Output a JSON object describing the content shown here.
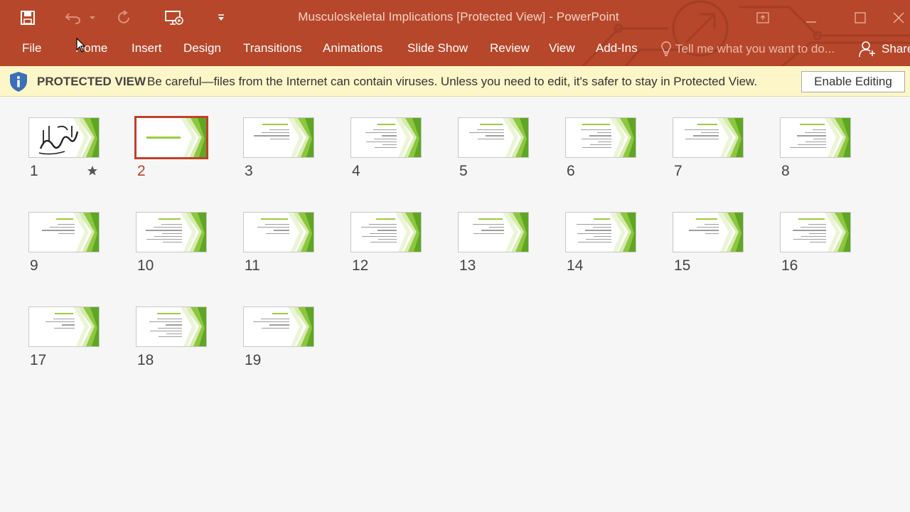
{
  "window": {
    "title": "Musculoskeletal Implications [Protected View] - PowerPoint"
  },
  "colors": {
    "accent": "#b7472a",
    "selected": "#c0412a",
    "protected_bar": "#fdf6c8",
    "thumb_green": "#8dc63f"
  },
  "quick_access": {
    "save_icon": "save-icon",
    "undo_icon": "undo-icon",
    "redo_icon": "redo-icon",
    "present_icon": "present-from-beginning-icon",
    "customize_icon": "customize-toolbar-icon"
  },
  "ribbon": {
    "tabs": [
      "File",
      "Home",
      "Insert",
      "Design",
      "Transitions",
      "Animations",
      "Slide Show",
      "Review",
      "View",
      "Add-Ins"
    ],
    "tell_me": "Tell me what you want to do...",
    "share": "Share"
  },
  "protected_view": {
    "title": "PROTECTED VIEW",
    "message": "Be careful—files from the Internet can contain viruses. Unless you need to edit, it's safer to stay in Protected View.",
    "enable_button": "Enable Editing"
  },
  "sorter": {
    "selected_slide": 2,
    "slides": [
      {
        "number": "1",
        "has_animation": true
      },
      {
        "number": "2",
        "has_animation": false
      },
      {
        "number": "3",
        "has_animation": false
      },
      {
        "number": "4",
        "has_animation": false
      },
      {
        "number": "5",
        "has_animation": false
      },
      {
        "number": "6",
        "has_animation": false
      },
      {
        "number": "7",
        "has_animation": false
      },
      {
        "number": "8",
        "has_animation": false
      },
      {
        "number": "9",
        "has_animation": false
      },
      {
        "number": "10",
        "has_animation": false
      },
      {
        "number": "11",
        "has_animation": false
      },
      {
        "number": "12",
        "has_animation": false
      },
      {
        "number": "13",
        "has_animation": false
      },
      {
        "number": "14",
        "has_animation": false
      },
      {
        "number": "15",
        "has_animation": false
      },
      {
        "number": "16",
        "has_animation": false
      },
      {
        "number": "17",
        "has_animation": false
      },
      {
        "number": "18",
        "has_animation": false
      },
      {
        "number": "19",
        "has_animation": false
      }
    ]
  }
}
